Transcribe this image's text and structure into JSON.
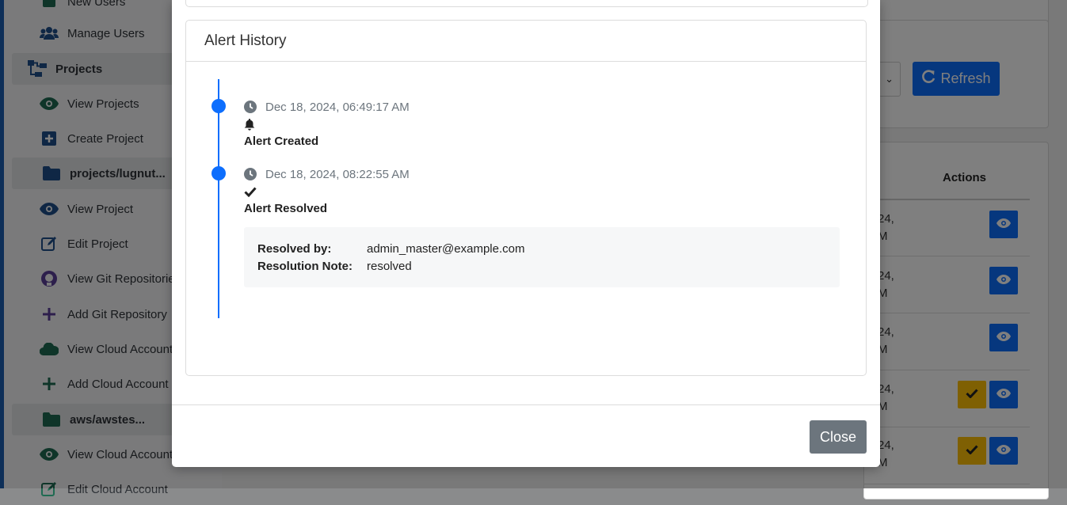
{
  "sidebar": {
    "items": [
      {
        "label": "New Users",
        "icon": "user-plus-icon",
        "type": "link"
      },
      {
        "label": "Manage Users",
        "icon": "users-icon",
        "type": "link"
      },
      {
        "label": "Projects",
        "icon": "sitemap-icon",
        "type": "group"
      },
      {
        "label": "View Projects",
        "icon": "eye-icon",
        "type": "link"
      },
      {
        "label": "Create Project",
        "icon": "plus-square-icon",
        "type": "link"
      },
      {
        "label": "projects/lugnut...",
        "icon": "folder-icon",
        "type": "folder"
      },
      {
        "label": "View Project",
        "icon": "eye-icon",
        "type": "link"
      },
      {
        "label": "Edit Project",
        "icon": "edit-icon",
        "type": "link"
      },
      {
        "label": "View Git Repositories",
        "icon": "github-icon",
        "type": "link"
      },
      {
        "label": "Add Git Repository",
        "icon": "plus-icon",
        "type": "link"
      },
      {
        "label": "View Cloud Accounts",
        "icon": "cloud-icon",
        "type": "link"
      },
      {
        "label": "Add Cloud Account",
        "icon": "plus-icon",
        "type": "link"
      },
      {
        "label": "aws/awstes...",
        "icon": "folder-icon",
        "type": "folder"
      },
      {
        "label": "View Cloud Account",
        "icon": "eye-icon",
        "type": "link"
      },
      {
        "label": "Edit Cloud Account",
        "icon": "edit-icon",
        "type": "link"
      }
    ]
  },
  "main": {
    "refresh_label": "Refresh",
    "actions_header": "Actions",
    "rows": [
      {
        "date_part1": "24,",
        "date_part2": "M",
        "has_resolve": false
      },
      {
        "date_part1": "24,",
        "date_part2": "M",
        "has_resolve": false
      },
      {
        "date_part1": "24,",
        "date_part2": "M",
        "has_resolve": false
      },
      {
        "date_part1": "24,",
        "date_part2": "M",
        "has_resolve": true
      },
      {
        "date_part1": "24,",
        "date_part2": "M",
        "has_resolve": true
      }
    ]
  },
  "modal": {
    "card_title": "Alert History",
    "timeline": [
      {
        "timestamp": "Dec 18, 2024, 06:49:17 AM",
        "icon": "bell-icon",
        "title": "Alert Created"
      },
      {
        "timestamp": "Dec 18, 2024, 08:22:55 AM",
        "icon": "check-icon",
        "title": "Alert Resolved"
      }
    ],
    "resolution": {
      "resolved_by_label": "Resolved by:",
      "resolved_by_value": "admin_master@example.com",
      "note_label": "Resolution Note:",
      "note_value": "resolved"
    },
    "close_label": "Close"
  },
  "colors": {
    "primary": "#0d6efd",
    "secondary": "#6c757d",
    "warning": "#ffc107",
    "sidebar_accent": "#1d5fb0"
  }
}
